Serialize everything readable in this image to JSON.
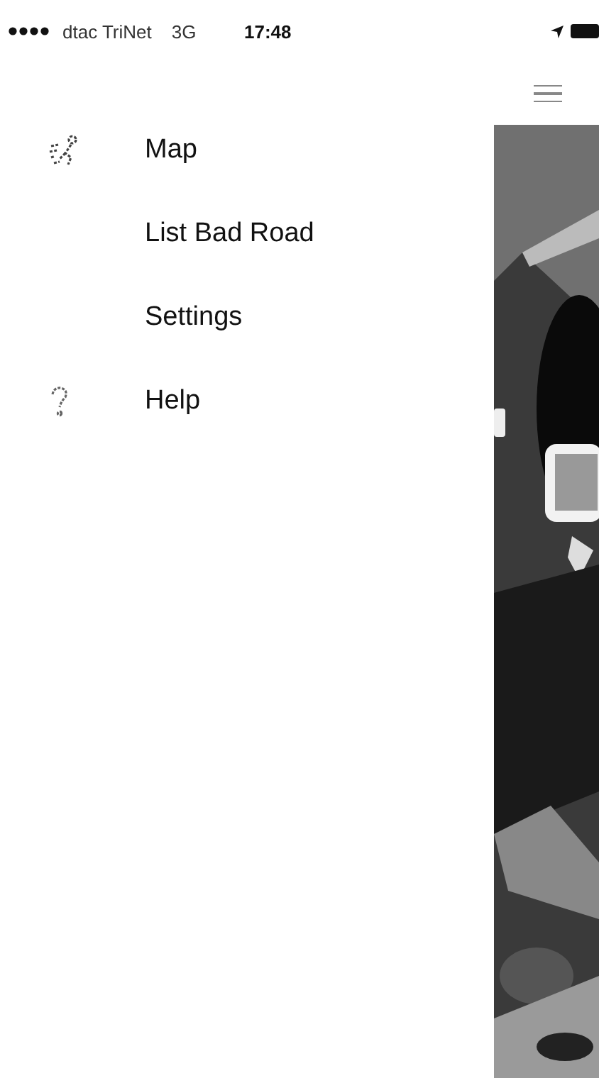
{
  "status_bar": {
    "carrier": "dtac TriNet",
    "network": "3G",
    "time": "17:48"
  },
  "menu": {
    "items": [
      {
        "label": "Map",
        "kind": "map"
      },
      {
        "label": "List Bad Road",
        "kind": "plain"
      },
      {
        "label": "Settings",
        "kind": "plain"
      },
      {
        "label": "Help",
        "kind": "help"
      }
    ]
  }
}
